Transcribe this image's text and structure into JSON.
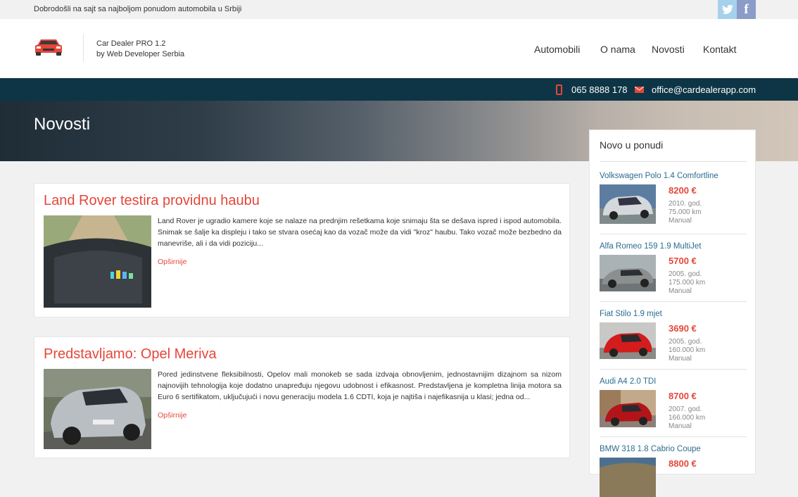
{
  "topbar": {
    "welcome": "Dobrodošli na sajt sa najboljom ponudom automobila u Srbiji",
    "twitter": "t",
    "facebook": "f"
  },
  "brand": {
    "line1": "Car Dealer PRO 1.2",
    "line2": "by Web Developer Serbia"
  },
  "nav": {
    "items": [
      "Automobili",
      "O nama",
      "Novosti",
      "Kontakt"
    ]
  },
  "contact": {
    "phone": "065 8888 178",
    "email": "office@cardealerapp.com"
  },
  "hero": {
    "title": "Novosti"
  },
  "articles": [
    {
      "title": "Land Rover testira providnu haubu",
      "text": "Land Rover je ugradio kamere koje se nalaze na prednjim rešetkama koje snimaju šta se dešava ispred i ispod automobila. Snimak se šalje ka displeju i tako se stvara osećaj kao da vozač može da vidi \"kroz\" haubu. Tako vozač može bezbedno da manevriše, ali i da vidi poziciju...",
      "more": "Opširnije"
    },
    {
      "title": "Predstavljamo: Opel Meriva",
      "text": "Pored jedinstvene fleksibilnosti, Opelov mali monokeb se sada izdvaja obnovljenim, jednostavnijim dizajnom sa nizom najnovijih tehnologija koje dodatno unapređuju njegovu udobnost i efikasnost. Predstavljena je kompletna linija motora sa Euro 6 sertifikatom, uključujući i novu generaciju modela 1.6 CDTI, koja je najtiša i najefikasnija u klasi; jedna od...",
      "more": "Opširnije"
    }
  ],
  "sidebar": {
    "title": "Novo u ponudi",
    "items": [
      {
        "name": "Volkswagen Polo 1.4 Comfortline",
        "price": "8200 €",
        "year": "2010. god.",
        "km": "75.000 km",
        "trans": "Manual",
        "color": "#cfd3d6"
      },
      {
        "name": "Alfa Romeo 159 1.9 MultiJet",
        "price": "5700 €",
        "year": "2005. god.",
        "km": "175.000 km",
        "trans": "Manual",
        "color": "#8c8f8f"
      },
      {
        "name": "Fiat Stilo 1.9 mjet",
        "price": "3690 €",
        "year": "2005. god.",
        "km": "160.000 km",
        "trans": "Manual",
        "color": "#d41c1c"
      },
      {
        "name": "Audi A4 2.0 TDI",
        "price": "8700 €",
        "year": "2007. god.",
        "km": "166.000 km",
        "trans": "Manual",
        "color": "#b3141a"
      },
      {
        "name": "BMW 318 1.8 Cabrio Coupe",
        "price": "8800 €",
        "year": "",
        "km": "",
        "trans": "",
        "color": "#8a7a5a"
      }
    ]
  }
}
